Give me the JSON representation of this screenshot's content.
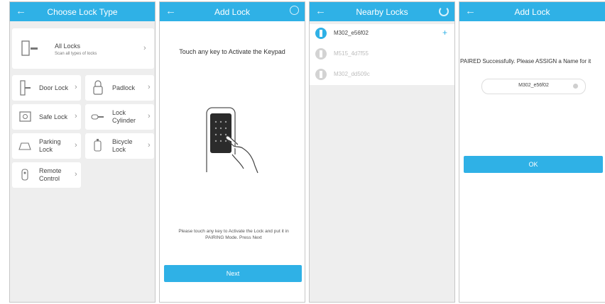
{
  "screen1": {
    "title": "Choose Lock Type",
    "all_locks": {
      "label": "All Locks",
      "sub": "Scan all types of locks"
    },
    "items": [
      {
        "label": "Door Lock"
      },
      {
        "label": "Padlock"
      },
      {
        "label": "Safe Lock"
      },
      {
        "label": "Lock Cylinder"
      },
      {
        "label": "Parking Lock"
      },
      {
        "label": "Bicycle Lock"
      },
      {
        "label": "Remote Control"
      }
    ]
  },
  "screen2": {
    "title": "Add Lock",
    "heading": "Touch any key to Activate the Keypad",
    "instructions": "Please touch any key to Activate the Lock and put it in PAIRING Mode. Press Next",
    "next_label": "Next"
  },
  "screen3": {
    "title": "Nearby Locks",
    "devices": [
      {
        "name": "M302_e56f02",
        "state": "active"
      },
      {
        "name": "M515_4d7f55",
        "state": "inactive"
      },
      {
        "name": "M302_dd509c",
        "state": "inactive"
      }
    ]
  },
  "screen4": {
    "title": "Add Lock",
    "message": "PAIRED Successfully. Please ASSIGN a Name for it",
    "name_value": "M302_e56f02",
    "ok_label": "OK"
  },
  "colors": {
    "accent": "#2fb1e6"
  }
}
